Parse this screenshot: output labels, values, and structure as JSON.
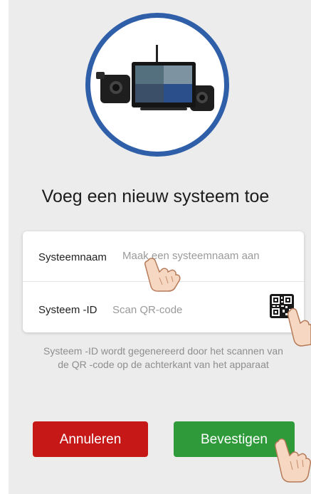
{
  "header": {
    "title": "Voeg een nieuw systeem toe"
  },
  "form": {
    "name_label": "Systeemnaam",
    "name_placeholder": "Maak een systeemnaam aan",
    "id_label": "Systeem -ID",
    "id_action": "Scan QR-code"
  },
  "hint": {
    "line1": "Systeem -ID wordt gegenereerd door het scannen van",
    "line2": "de QR -code op de achterkant van het apparaat"
  },
  "buttons": {
    "cancel_label": "Annuleren",
    "confirm_label": "Bevestigen"
  },
  "icons": {
    "product": "camera-system-product-image",
    "qr": "qr-code-icon",
    "hand": "pointing-hand-icon"
  },
  "colors": {
    "accent_ring": "#2e5fa8",
    "cancel": "#c71818",
    "confirm": "#2e9a3a"
  }
}
